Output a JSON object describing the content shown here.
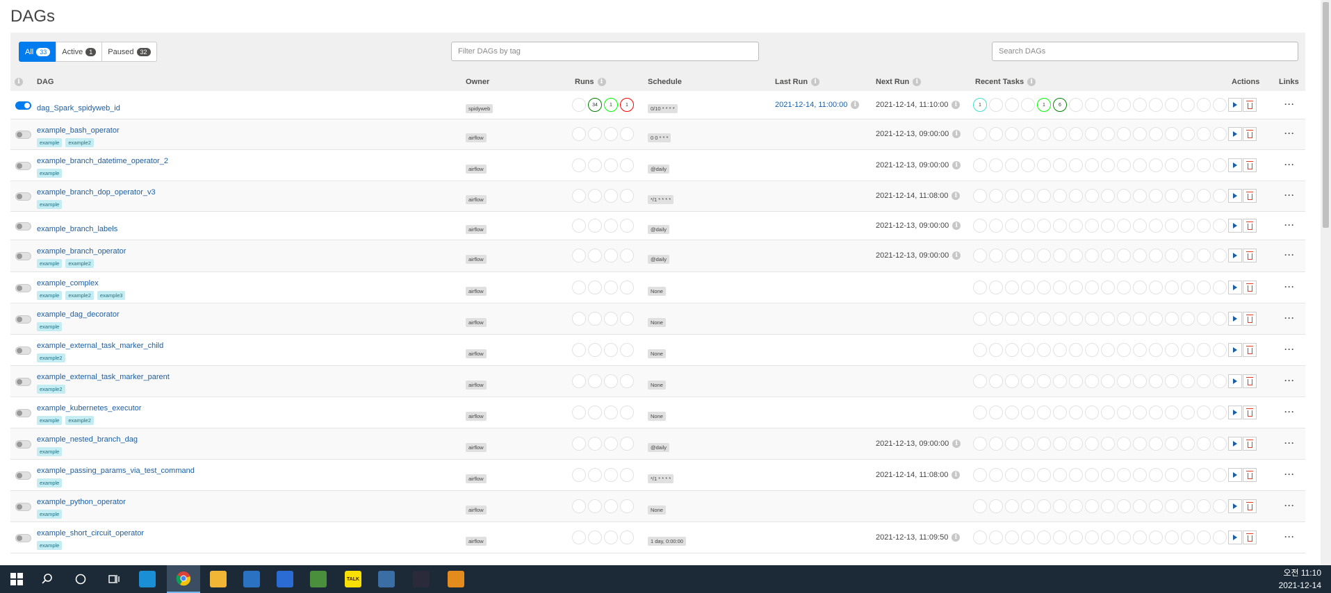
{
  "page_title": "DAGs",
  "filters": [
    {
      "label": "All",
      "count": "33"
    },
    {
      "label": "Active",
      "count": "1"
    },
    {
      "label": "Paused",
      "count": "32"
    }
  ],
  "tag_filter_placeholder": "Filter DAGs by tag",
  "search_placeholder": "Search DAGs",
  "columns": {
    "dag": "DAG",
    "owner": "Owner",
    "runs": "Runs",
    "schedule": "Schedule",
    "last_run": "Last Run",
    "next_run": "Next Run",
    "recent_tasks": "Recent Tasks",
    "actions": "Actions",
    "links": "Links"
  },
  "colors": {
    "accent": "#017cee",
    "success": "#008000",
    "running": "#00ff00",
    "failed": "#ff0000",
    "queued": "#808080",
    "scheduled": "#d2b48c",
    "upstream_failed": "#ffa500",
    "skipped": "#ff69b4",
    "up_for_retry": "#ffd700",
    "up_for_reschedule": "#40e0d0",
    "removed": "#d3d3d3",
    "deferred": "#9370db",
    "tag_bg": "#c4ecf3"
  },
  "dags": [
    {
      "name": "dag_Spark_spidyweb_id",
      "active": true,
      "tags": [],
      "owner": "spidyweb",
      "schedule": "0/10 * * * *",
      "last_run": "2021-12-14, 11:00:00",
      "next_run": "2021-12-14, 11:10:00",
      "runs": [
        "",
        "34",
        "1",
        "1"
      ],
      "tasks": [
        "1",
        "",
        "",
        "",
        "1",
        "6",
        "",
        "",
        "",
        "",
        "",
        "",
        "",
        "",
        "",
        ""
      ]
    },
    {
      "name": "example_bash_operator",
      "active": false,
      "tags": [
        "example",
        "example2"
      ],
      "owner": "airflow",
      "schedule": "0 0 * * *",
      "last_run": "",
      "next_run": "2021-12-13, 09:00:00"
    },
    {
      "name": "example_branch_datetime_operator_2",
      "active": false,
      "tags": [
        "example"
      ],
      "owner": "airflow",
      "schedule": "@daily",
      "last_run": "",
      "next_run": "2021-12-13, 09:00:00"
    },
    {
      "name": "example_branch_dop_operator_v3",
      "active": false,
      "tags": [
        "example"
      ],
      "owner": "airflow",
      "schedule": "*/1 * * * *",
      "last_run": "",
      "next_run": "2021-12-14, 11:08:00"
    },
    {
      "name": "example_branch_labels",
      "active": false,
      "tags": [],
      "owner": "airflow",
      "schedule": "@daily",
      "last_run": "",
      "next_run": "2021-12-13, 09:00:00"
    },
    {
      "name": "example_branch_operator",
      "active": false,
      "tags": [
        "example",
        "example2"
      ],
      "owner": "airflow",
      "schedule": "@daily",
      "last_run": "",
      "next_run": "2021-12-13, 09:00:00"
    },
    {
      "name": "example_complex",
      "active": false,
      "tags": [
        "example",
        "example2",
        "example3"
      ],
      "owner": "airflow",
      "schedule": "None",
      "last_run": "",
      "next_run": ""
    },
    {
      "name": "example_dag_decorator",
      "active": false,
      "tags": [
        "example"
      ],
      "owner": "airflow",
      "schedule": "None",
      "last_run": "",
      "next_run": ""
    },
    {
      "name": "example_external_task_marker_child",
      "active": false,
      "tags": [
        "example2"
      ],
      "owner": "airflow",
      "schedule": "None",
      "last_run": "",
      "next_run": ""
    },
    {
      "name": "example_external_task_marker_parent",
      "active": false,
      "tags": [
        "example2"
      ],
      "owner": "airflow",
      "schedule": "None",
      "last_run": "",
      "next_run": ""
    },
    {
      "name": "example_kubernetes_executor",
      "active": false,
      "tags": [
        "example",
        "example2"
      ],
      "owner": "airflow",
      "schedule": "None",
      "last_run": "",
      "next_run": ""
    },
    {
      "name": "example_nested_branch_dag",
      "active": false,
      "tags": [
        "example"
      ],
      "owner": "airflow",
      "schedule": "@daily",
      "last_run": "",
      "next_run": "2021-12-13, 09:00:00"
    },
    {
      "name": "example_passing_params_via_test_command",
      "active": false,
      "tags": [
        "example"
      ],
      "owner": "airflow",
      "schedule": "*/1 * * * *",
      "last_run": "",
      "next_run": "2021-12-14, 11:08:00"
    },
    {
      "name": "example_python_operator",
      "active": false,
      "tags": [
        "example"
      ],
      "owner": "airflow",
      "schedule": "None",
      "last_run": "",
      "next_run": ""
    },
    {
      "name": "example_short_circuit_operator",
      "active": false,
      "tags": [
        "example"
      ],
      "owner": "airflow",
      "schedule": "1 day, 0:00:00",
      "last_run": "",
      "next_run": "2021-12-13, 11:09:50"
    }
  ],
  "run_states": [
    "",
    "success",
    "running",
    "failed"
  ],
  "task_states": [
    "up_for_reschedule",
    "",
    "",
    "",
    "running",
    "success",
    "",
    "",
    "",
    "",
    "",
    "",
    "",
    "",
    "",
    ""
  ],
  "taskbar": {
    "apps": [
      "start-icon",
      "search-icon",
      "cortana-icon",
      "task-view-icon",
      "edge-icon",
      "chrome-icon",
      "file-explorer-icon",
      "store-icon",
      "mail-icon",
      "notepad-icon",
      "kakaotalk-icon",
      "virtualbox-icon",
      "photos-icon",
      "app-icon"
    ],
    "kakao_label": "TALK",
    "time": "오전 11:10",
    "date": "2021-12-14"
  }
}
